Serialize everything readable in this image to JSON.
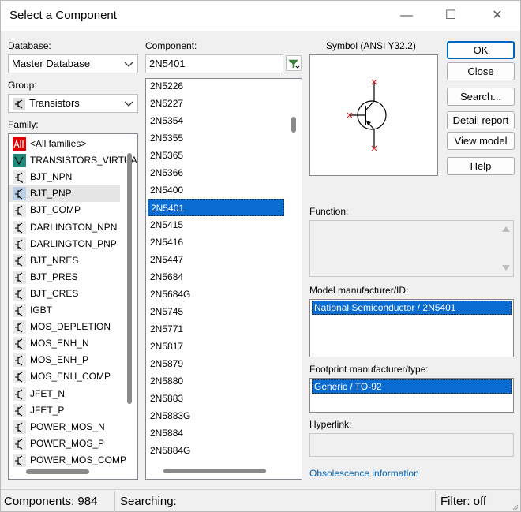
{
  "window": {
    "title": "Select a Component",
    "minimize_glyph": "—",
    "maximize_glyph": "☐",
    "close_glyph": "✕"
  },
  "database": {
    "label": "Database:",
    "value": "Master Database"
  },
  "group": {
    "label": "Group:",
    "value": "Transistors",
    "icon": "transistor-icon"
  },
  "family": {
    "label": "Family:",
    "items": [
      {
        "label": "<All families>",
        "icon": "all-icon",
        "selected": false
      },
      {
        "label": "TRANSISTORS_VIRTUAL",
        "icon": "virtual-transistor-icon",
        "selected": false
      },
      {
        "label": "BJT_NPN",
        "icon": "npn-icon",
        "selected": false
      },
      {
        "label": "BJT_PNP",
        "icon": "pnp-icon",
        "selected": true
      },
      {
        "label": "BJT_COMP",
        "icon": "bjt-comp-icon",
        "selected": false
      },
      {
        "label": "DARLINGTON_NPN",
        "icon": "darlington-npn-icon",
        "selected": false
      },
      {
        "label": "DARLINGTON_PNP",
        "icon": "darlington-pnp-icon",
        "selected": false
      },
      {
        "label": "BJT_NRES",
        "icon": "bjt-nres-icon",
        "selected": false
      },
      {
        "label": "BJT_PRES",
        "icon": "bjt-pres-icon",
        "selected": false
      },
      {
        "label": "BJT_CRES",
        "icon": "bjt-cres-icon",
        "selected": false
      },
      {
        "label": "IGBT",
        "icon": "igbt-icon",
        "selected": false
      },
      {
        "label": "MOS_DEPLETION",
        "icon": "mos-depletion-icon",
        "selected": false
      },
      {
        "label": "MOS_ENH_N",
        "icon": "mos-enh-n-icon",
        "selected": false
      },
      {
        "label": "MOS_ENH_P",
        "icon": "mos-enh-p-icon",
        "selected": false
      },
      {
        "label": "MOS_ENH_COMP",
        "icon": "mos-enh-comp-icon",
        "selected": false
      },
      {
        "label": "JFET_N",
        "icon": "jfet-n-icon",
        "selected": false
      },
      {
        "label": "JFET_P",
        "icon": "jfet-p-icon",
        "selected": false
      },
      {
        "label": "POWER_MOS_N",
        "icon": "power-mos-n-icon",
        "selected": false
      },
      {
        "label": "POWER_MOS_P",
        "icon": "power-mos-p-icon",
        "selected": false
      },
      {
        "label": "POWER_MOS_COMP",
        "icon": "power-mos-comp-icon",
        "selected": false
      }
    ]
  },
  "component": {
    "label": "Component:",
    "value": "2N5401",
    "filter_icon": "filter-icon",
    "items": [
      "2N5226",
      "2N5227",
      "2N5354",
      "2N5355",
      "2N5365",
      "2N5366",
      "2N5400",
      "2N5401",
      "2N5415",
      "2N5416",
      "2N5447",
      "2N5684",
      "2N5684G",
      "2N5745",
      "2N5771",
      "2N5817",
      "2N5879",
      "2N5880",
      "2N5883",
      "2N5883G",
      "2N5884",
      "2N5884G"
    ],
    "selected_index": 7
  },
  "symbol": {
    "label": "Symbol (ANSI Y32.2)"
  },
  "buttons": {
    "ok": "OK",
    "close": "Close",
    "search": "Search...",
    "detail_report": "Detail report",
    "view_model": "View model",
    "help": "Help"
  },
  "function": {
    "label": "Function:",
    "value": ""
  },
  "model": {
    "label": "Model manufacturer/ID:",
    "items": [
      "National Semiconductor / 2N5401"
    ]
  },
  "footprint": {
    "label": "Footprint manufacturer/type:",
    "items": [
      "Generic / TO-92"
    ]
  },
  "hyperlink": {
    "label": "Hyperlink:",
    "value": ""
  },
  "obsolescence_link": "Obsolescence information",
  "status": {
    "components": "Components: 984",
    "searching": "Searching:",
    "filter": "Filter: off"
  },
  "colors": {
    "selection": "#0a6bd0",
    "accent": "#0067c0",
    "symbol_red": "#e02020",
    "all_icon_bg": "#e00000",
    "virtual_icon_bg": "#1f8a7a",
    "pnp_selected_bg": "#e5e5e5"
  }
}
